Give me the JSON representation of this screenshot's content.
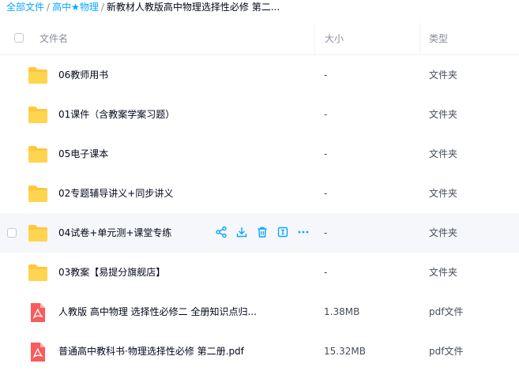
{
  "breadcrumb": {
    "items": [
      "全部文件",
      "高中★物理"
    ],
    "current": "新教材人教版高中物理选择性必修 第二...",
    "separator": "/"
  },
  "table": {
    "headers": {
      "name": "文件名",
      "size": "大小",
      "type": "类型"
    },
    "rows": [
      {
        "name": "06教师用书",
        "size": "-",
        "type": "文件夹",
        "icon": "folder-icon"
      },
      {
        "name": "01课件（含教案学案习题）",
        "size": "-",
        "type": "文件夹",
        "icon": "folder-icon"
      },
      {
        "name": "05电子课本",
        "size": "-",
        "type": "文件夹",
        "icon": "folder-icon"
      },
      {
        "name": "02专题辅导讲义+同步讲义",
        "size": "-",
        "type": "文件夹",
        "icon": "folder-icon"
      },
      {
        "name": "04试卷+单元测+课堂专练",
        "size": "-",
        "type": "文件夹",
        "icon": "folder-icon",
        "hovered": true
      },
      {
        "name": "03教案【易提分旗舰店】",
        "size": "-",
        "type": "文件夹",
        "icon": "folder-icon"
      },
      {
        "name": "人教版 高中物理 选择性必修二 全册知识点归...",
        "size": "1.38MB",
        "type": "pdf文件",
        "icon": "pdf-icon"
      },
      {
        "name": "普通高中教科书·物理选择性必修 第二册.pdf",
        "size": "15.32MB",
        "type": "pdf文件",
        "icon": "pdf-icon"
      }
    ]
  },
  "row_actions": [
    "share-icon",
    "download-icon",
    "delete-icon",
    "rename-icon",
    "more-icon"
  ],
  "colors": {
    "accent": "#06a7ff",
    "folder": "#ffc63f",
    "pdf": "#fa5b5b",
    "hover_row": "#f6f7fa"
  }
}
